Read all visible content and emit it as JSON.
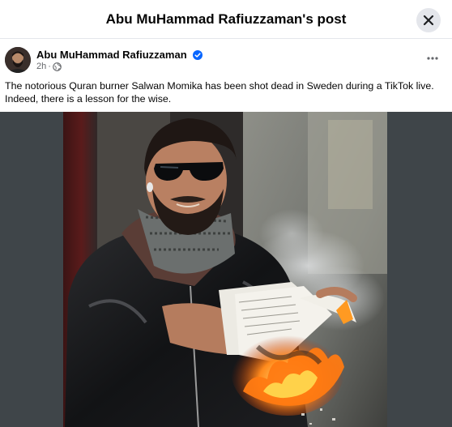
{
  "dialog": {
    "title": "Abu MuHammad Rafiuzzaman's post",
    "close_icon": "close-icon"
  },
  "post": {
    "author": "Abu MuHammad Rafiuzzaman",
    "verified_icon": "verified-badge-icon",
    "time": "2h",
    "separator": "·",
    "audience_icon": "globe-icon",
    "more_icon": "more-dots-icon",
    "text": "The notorious Quran burner Salwan Momika has been shot dead in Sweden during a TikTok live. Indeed, there is a lesson for the wise."
  },
  "colors": {
    "verified_blue": "#0866ff",
    "meta_gray": "#65676b",
    "close_bg": "#e4e6eb",
    "media_bg": "#3f4549"
  }
}
